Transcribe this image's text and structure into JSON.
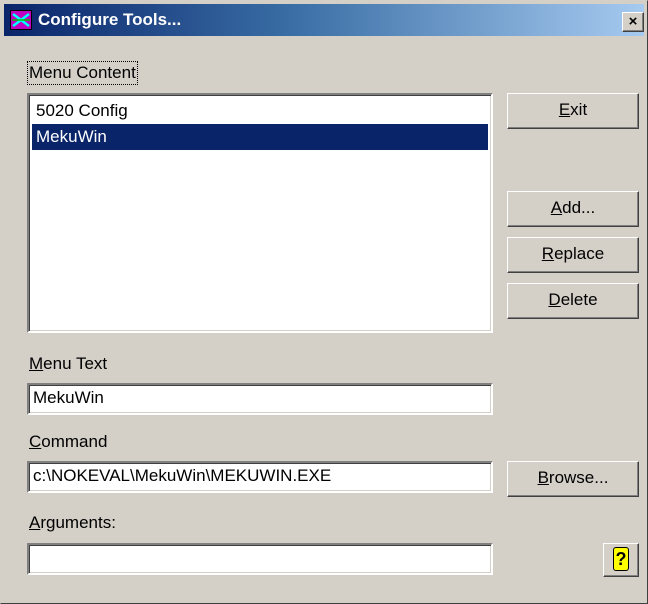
{
  "window": {
    "title": "Configure Tools...",
    "icon": "app-icon",
    "close_label": "×"
  },
  "menu_content": {
    "label_underline": "",
    "label_rest": "Menu Content",
    "items": [
      {
        "label": "5020 Config",
        "selected": false
      },
      {
        "label": "MekuWin",
        "selected": true
      }
    ]
  },
  "buttons": {
    "exit": {
      "u": "E",
      "rest": "xit"
    },
    "add": {
      "u": "A",
      "rest": "dd..."
    },
    "replace": {
      "u": "R",
      "rest": "eplace"
    },
    "delete": {
      "u": "D",
      "rest": "elete"
    },
    "browse": {
      "u": "B",
      "rest": "rowse..."
    },
    "help_icon": "help-icon"
  },
  "menu_text": {
    "label_u": "M",
    "label_rest": "enu Text",
    "value": "MekuWin"
  },
  "command": {
    "label_u": "C",
    "label_rest": "ommand",
    "value": "c:\\NOKEVAL\\MekuWin\\MEKUWIN.EXE"
  },
  "arguments": {
    "label_u": "A",
    "label_rest": "rguments:",
    "value": ""
  },
  "colors": {
    "face": "#d4d0c8",
    "titlebar_start": "#0a246a",
    "titlebar_end": "#a6caf0",
    "selection": "#0a246a"
  }
}
